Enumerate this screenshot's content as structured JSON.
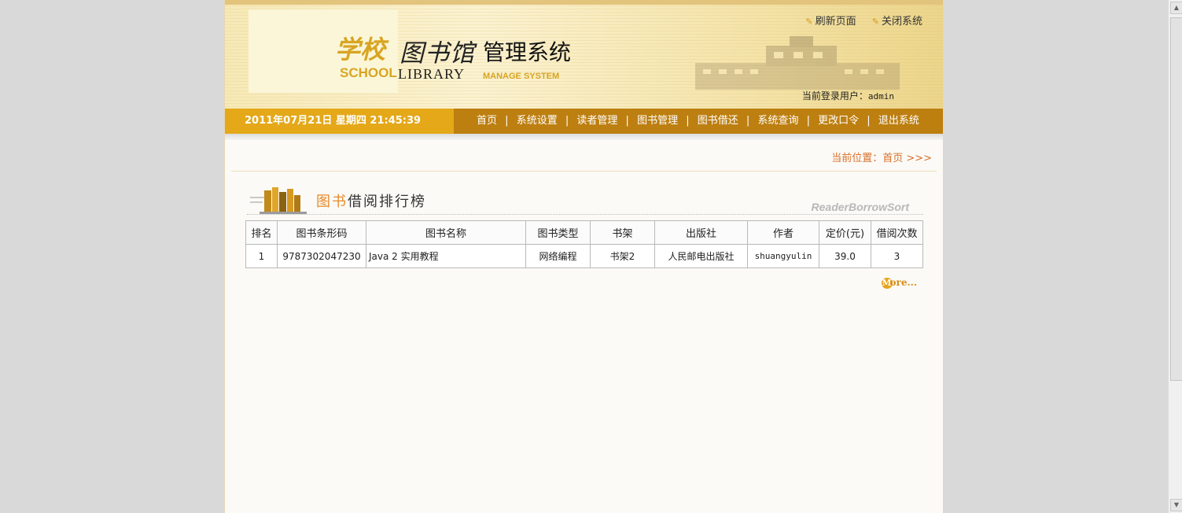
{
  "header": {
    "logo": {
      "xuexiao": "学校",
      "tushuguan": "图书馆",
      "guanli": "管理系统",
      "school": "SCHOOL",
      "library": "LIBRARY",
      "manage": "MANAGE SYSTEM"
    },
    "links": {
      "refresh": "刷新页面",
      "close": "关闭系统"
    },
    "login_label": "当前登录用户：",
    "login_user": "admin"
  },
  "navbar": {
    "datetime": "2011年07月21日 星期四 21:45:39",
    "items": [
      "首页",
      "系统设置",
      "读者管理",
      "图书管理",
      "图书借还",
      "系统查询",
      "更改口令",
      "退出系统"
    ],
    "separator": "|"
  },
  "location": "当前位置：首页 >>>",
  "section": {
    "title_part1": "图书",
    "title_part2": "借阅排行榜",
    "title_en": "ReaderBorrowSort"
  },
  "table": {
    "headers": [
      "排名",
      "图书条形码",
      "图书名称",
      "图书类型",
      "书架",
      "出版社",
      "作者",
      "定价(元)",
      "借阅次数"
    ],
    "rows": [
      [
        "1",
        "9787302047230",
        "Java 2 实用教程",
        "网络编程",
        "书架2",
        "人民邮电出版社",
        "shuangyulin",
        "39.0",
        "3"
      ]
    ]
  },
  "more": {
    "m": "M",
    "rest": "ore..."
  },
  "colors": {
    "nav_bar": "#bd7f10",
    "date_box": "#e4a818",
    "accent_orange": "#e68a2a",
    "location_text": "#d9702a"
  },
  "icons": {
    "toplink_bullet": "feather-icon",
    "section": "books-icon"
  }
}
